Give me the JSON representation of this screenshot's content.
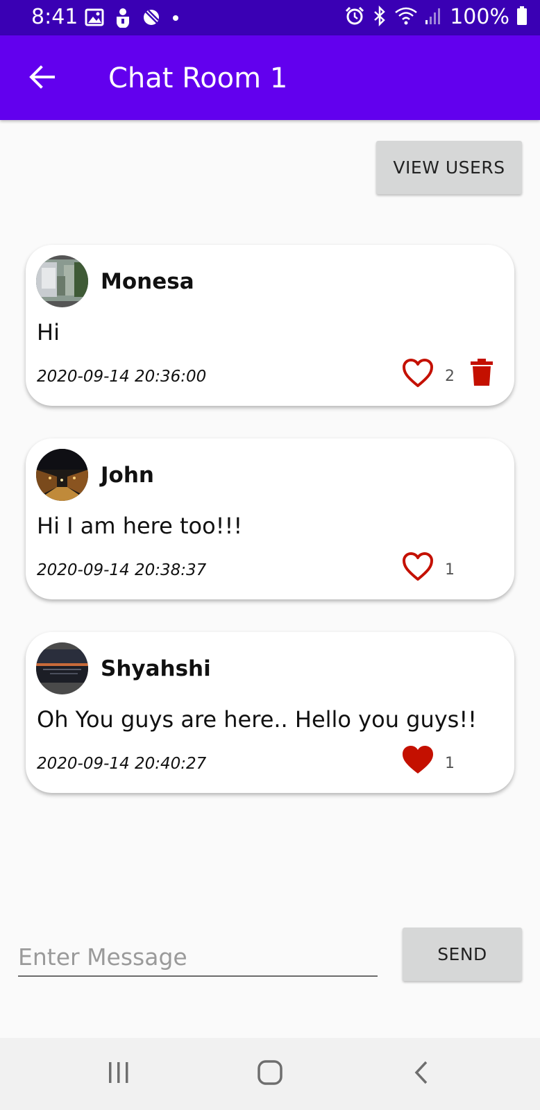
{
  "status_bar": {
    "time": "8:41",
    "battery": "100%",
    "left_icons": [
      "image-icon",
      "android-debug-icon",
      "data-saver-icon",
      "notification-dot-icon"
    ],
    "right_icons": [
      "alarm-icon",
      "bluetooth-icon",
      "wifi-icon",
      "signal-icon",
      "battery-icon"
    ]
  },
  "app_bar": {
    "title": "Chat Room 1",
    "back_icon": "arrow-back-icon"
  },
  "view_users_label": "VIEW USERS",
  "messages": [
    {
      "author": "Monesa",
      "text": "Hi",
      "timestamp": "2020-09-14 20:36:00",
      "likes": "2",
      "liked": false,
      "deletable": true
    },
    {
      "author": "John",
      "text": "Hi I am here too!!!",
      "timestamp": "2020-09-14 20:38:37",
      "likes": "1",
      "liked": false,
      "deletable": false
    },
    {
      "author": "Shyahshi",
      "text": "Oh You guys are here.. Hello you guys!!",
      "timestamp": "2020-09-14 20:40:27",
      "likes": "1",
      "liked": true,
      "deletable": false
    }
  ],
  "composer": {
    "placeholder": "Enter Message",
    "value": "",
    "send_label": "SEND"
  },
  "nav_bar": {
    "icons": [
      "recent-apps-icon",
      "home-icon",
      "back-nav-icon"
    ]
  },
  "colors": {
    "status_bar": "#3a00b4",
    "app_bar": "#6200ee",
    "like_red": "#c41000",
    "background": "#fafafa"
  }
}
